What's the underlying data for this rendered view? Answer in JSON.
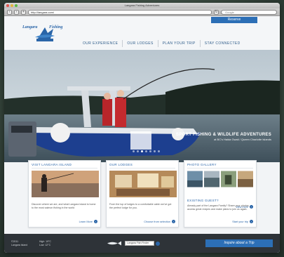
{
  "browser": {
    "title": "Langara Fishing Adventures",
    "url": "http://langara.com/",
    "search_placeholder": "Google"
  },
  "header": {
    "reserve_label": "Reserve",
    "logo_words": [
      "Langara",
      "Fishing"
    ]
  },
  "nav": [
    "OUR EXPERIENCE",
    "OUR LODGES",
    "PLAN YOUR TRIP",
    "STAY CONNECTED"
  ],
  "hero": {
    "title": "SPORT FISHING & WILDLIFE ADVENTURES",
    "subtitle": "at BC's Haida Gwaii / Queen Charlotte Islands",
    "slides": 7,
    "active_slide": 2
  },
  "cards": {
    "visit": {
      "title": "VISIT LANGARA ISLAND",
      "text": "Discover where we are, and what Langara Island is home to the most salmon fishing in the world",
      "link": "Learn More"
    },
    "lodges": {
      "title": "OUR LODGES",
      "text": "From the top of lodges to a comfortable cabin we've got the perfect lodge for you.",
      "link": "Choose from selection"
    },
    "gallery": {
      "title": "PHOTO GALLERY",
      "link": "View more"
    },
    "guest": {
      "title": "EXISTING GUEST?",
      "text": "Already part of the Langara Family? Share your photos, access great recipes and make plans to join us again.",
      "link": "Start your trip"
    }
  },
  "footer": {
    "left": [
      "©2011",
      "Langara Island"
    ],
    "mid": [
      "High: 19°C",
      "Low: 12°C"
    ],
    "select": "Langara Fish Finder",
    "inquire": "Inquire about a Trip"
  },
  "colors": {
    "accent": "#2c6fb6",
    "footer_bg": "#2e3338"
  }
}
